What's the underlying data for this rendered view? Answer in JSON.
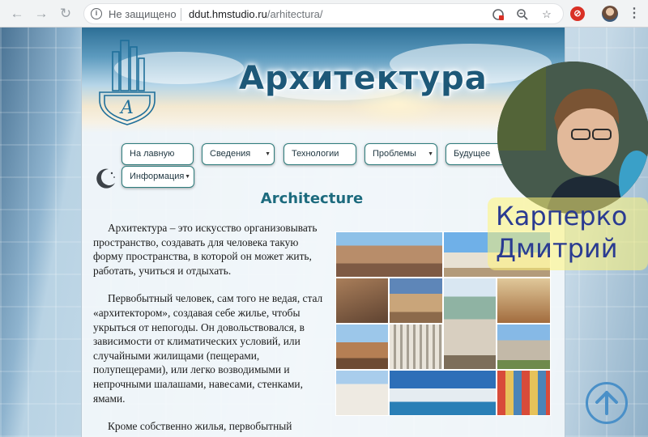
{
  "browser": {
    "insecure_label": "Не защищено",
    "url_host": "ddut.hmstudio.ru",
    "url_path": "/arhitectura/",
    "icons": [
      "back-icon",
      "forward-icon",
      "reload-icon",
      "info-icon",
      "translate-icon",
      "zoom-icon",
      "star-icon",
      "extension-icon",
      "profile-icon",
      "menu-icon"
    ]
  },
  "site": {
    "title": "Архитектура",
    "logo_monogram": "А"
  },
  "nav": {
    "items": [
      {
        "label": "На лавную",
        "dropdown": false
      },
      {
        "label": "Сведения",
        "dropdown": true
      },
      {
        "label": "Технологии",
        "dropdown": false
      },
      {
        "label": "Проблемы",
        "dropdown": true
      },
      {
        "label": "Будущее",
        "dropdown": false
      },
      {
        "label": "Информация",
        "dropdown": true
      }
    ]
  },
  "article": {
    "title": "Architecture",
    "paragraphs": [
      "Архитектура – это искусство организовывать пространство, создавать для человека такую форму пространства, в которой он может жить, работать, учиться и отдыхать.",
      "Первобытный человек, сам того не ведая, стал «архитектором», создавая себе жилье, чтобы укрыться от непогоды. Он довольствовался, в зависимости от климатических условий, или случайными жилищами (пещерами, полупещерами), или легко возводимыми и непрочными шалашами, навесами, стенками, ямами.",
      "Кроме собственно жилья, первобытный"
    ]
  },
  "overlay": {
    "name_line1": "Карперко",
    "name_line2": "Дмитрий"
  },
  "colors": {
    "title": "#1d5878",
    "heading": "#1d6b7e",
    "menu_border": "#2e7d7d",
    "name_text": "#2a3b91",
    "name_bg": "#fff478",
    "up_button": "#4a90c8"
  }
}
